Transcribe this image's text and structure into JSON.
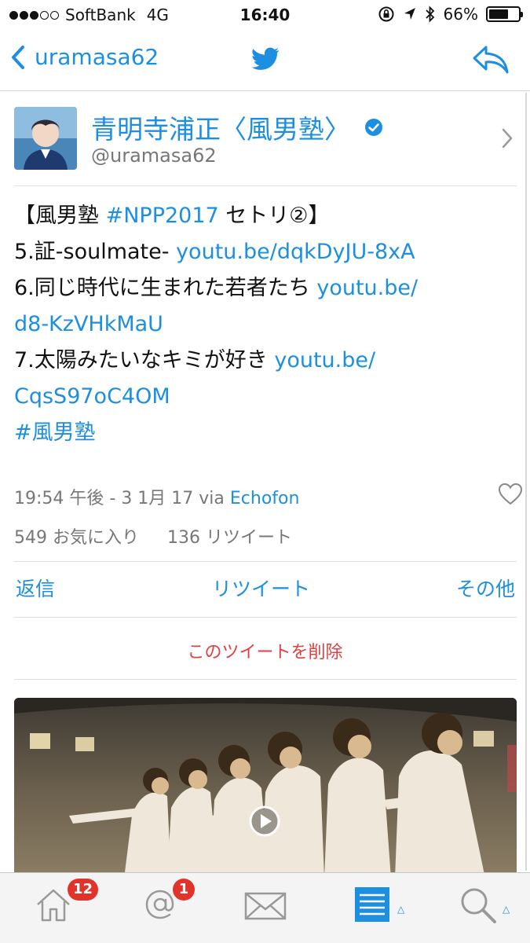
{
  "status_bar": {
    "carrier": "SoftBank",
    "network": "4G",
    "time": "16:40",
    "battery_percent": "66%",
    "battery_level": 0.66,
    "signal_bars_filled": 3,
    "signal_bars_total": 5
  },
  "nav": {
    "back_label": "uramasa62"
  },
  "profile": {
    "display_name": "青明寺浦正〈風男塾〉",
    "handle": "@uramasa62"
  },
  "tweet": {
    "line1_prefix": "【風男塾 ",
    "line1_hashtag": "#NPP2017",
    "line1_suffix": " セトリ②】",
    "line2_text": "5.証-soulmate- ",
    "line2_link": "youtu.be/dqkDyJU-8xA",
    "line3_text": "6.同じ時代に生まれた若者たち ",
    "line3_link": "youtu.be/",
    "line4_link": "d8-KzVHkMaU",
    "line5_text": "7.太陽みたいなキミが好き ",
    "line5_link": "youtu.be/",
    "line6_link": "CqsS97oC4OM",
    "line7_hashtag": "#風男塾"
  },
  "meta": {
    "timestamp": "19:54 午後 - 3 1月 17 via ",
    "via_app": "Echofon"
  },
  "stats": {
    "favorites": "549 お気に入り",
    "retweets": "136 リツイート"
  },
  "actions": {
    "reply": "返信",
    "retweet": "リツイート",
    "more": "その他"
  },
  "delete_label": "このツイートを削除",
  "tabbar": {
    "home_badge": "12",
    "mentions_badge": "1"
  },
  "colors": {
    "accent": "#1d8fe0",
    "delete": "#e0403f",
    "badge": "#e2332b"
  },
  "icons": [
    "back-chevron-icon",
    "twitter-bird-icon",
    "reply-icon",
    "verified-icon",
    "chevron-right-icon",
    "heart-icon",
    "play-icon",
    "home-icon",
    "mentions-icon",
    "messages-icon",
    "lists-icon",
    "search-icon"
  ]
}
